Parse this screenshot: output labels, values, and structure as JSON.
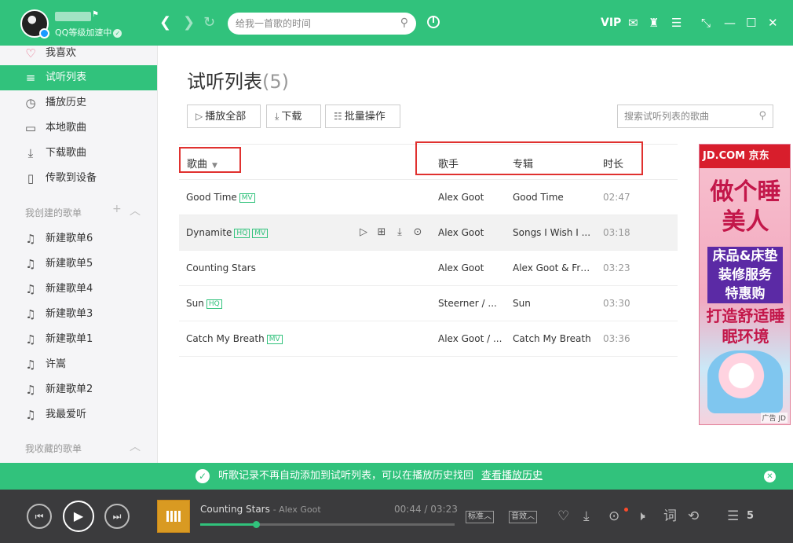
{
  "header": {
    "level_text": "QQ等级加速中",
    "search_placeholder": "给我一首歌的时间",
    "vip_label": "VIP"
  },
  "sidebar": {
    "top_items": [
      {
        "label": "我喜欢",
        "icon": "heart-icon"
      },
      {
        "label": "试听列表",
        "icon": "playlist-icon",
        "active": true
      },
      {
        "label": "播放历史",
        "icon": "clock-icon"
      },
      {
        "label": "本地歌曲",
        "icon": "monitor-icon"
      },
      {
        "label": "下载歌曲",
        "icon": "download-icon"
      },
      {
        "label": "传歌到设备",
        "icon": "device-icon"
      }
    ],
    "created_section_title": "我创建的歌单",
    "created_playlists": [
      "新建歌单6",
      "新建歌单5",
      "新建歌单4",
      "新建歌单3",
      "新建歌单1",
      "许嵩",
      "新建歌单2",
      "我最爱听"
    ],
    "collected_section_title": "我收藏的歌单"
  },
  "main": {
    "title": "试听列表",
    "count": "(5)",
    "buttons": {
      "play_all": "播放全部",
      "download": "下载",
      "batch": "批量操作"
    },
    "search_placeholder": "搜索试听列表的歌曲",
    "columns": {
      "song": "歌曲",
      "artist": "歌手",
      "album": "专辑",
      "duration": "时长"
    },
    "songs": [
      {
        "title": "Good Time",
        "tags": [
          "MV"
        ],
        "artist": "Alex Goot",
        "album": "Good Time",
        "duration": "02:47"
      },
      {
        "title": "Dynamite",
        "tags": [
          "HQ",
          "MV"
        ],
        "artist": "Alex Goot",
        "album": "Songs I Wish I ...",
        "duration": "03:18"
      },
      {
        "title": "Counting Stars",
        "tags": [],
        "artist": "Alex Goot",
        "album": "Alex Goot & Fri...",
        "duration": "03:23"
      },
      {
        "title": "Sun",
        "tags": [
          "HQ"
        ],
        "artist": "Steerner / ...",
        "album": "Sun",
        "duration": "03:30"
      },
      {
        "title": "Catch My Breath",
        "tags": [
          "MV"
        ],
        "artist": "Alex Goot / ...",
        "album": "Catch My Breath",
        "duration": "03:36"
      }
    ]
  },
  "ad": {
    "brand": "JD.COM 京东",
    "slogan": "做个睡美人",
    "offer_lines": [
      "床品&床垫",
      "装修服务",
      "特惠购"
    ],
    "tagline": "打造舒适睡眠环境",
    "label": "广告 JD"
  },
  "notice": {
    "text": "听歌记录不再自动添加到试听列表，可以在播放历史找回",
    "link": "查看播放历史"
  },
  "player": {
    "track_title": "Counting Stars",
    "track_artist": "- Alex Goot",
    "current_time": "00:44",
    "total_time": "03:23",
    "progress": 0.22,
    "quality_label": "标准",
    "effect_label": "音效",
    "queue_count": "5"
  },
  "colors": {
    "accent": "#31c27c",
    "highlight_box": "#e0312f",
    "player_bg": "#3b3b3d"
  }
}
